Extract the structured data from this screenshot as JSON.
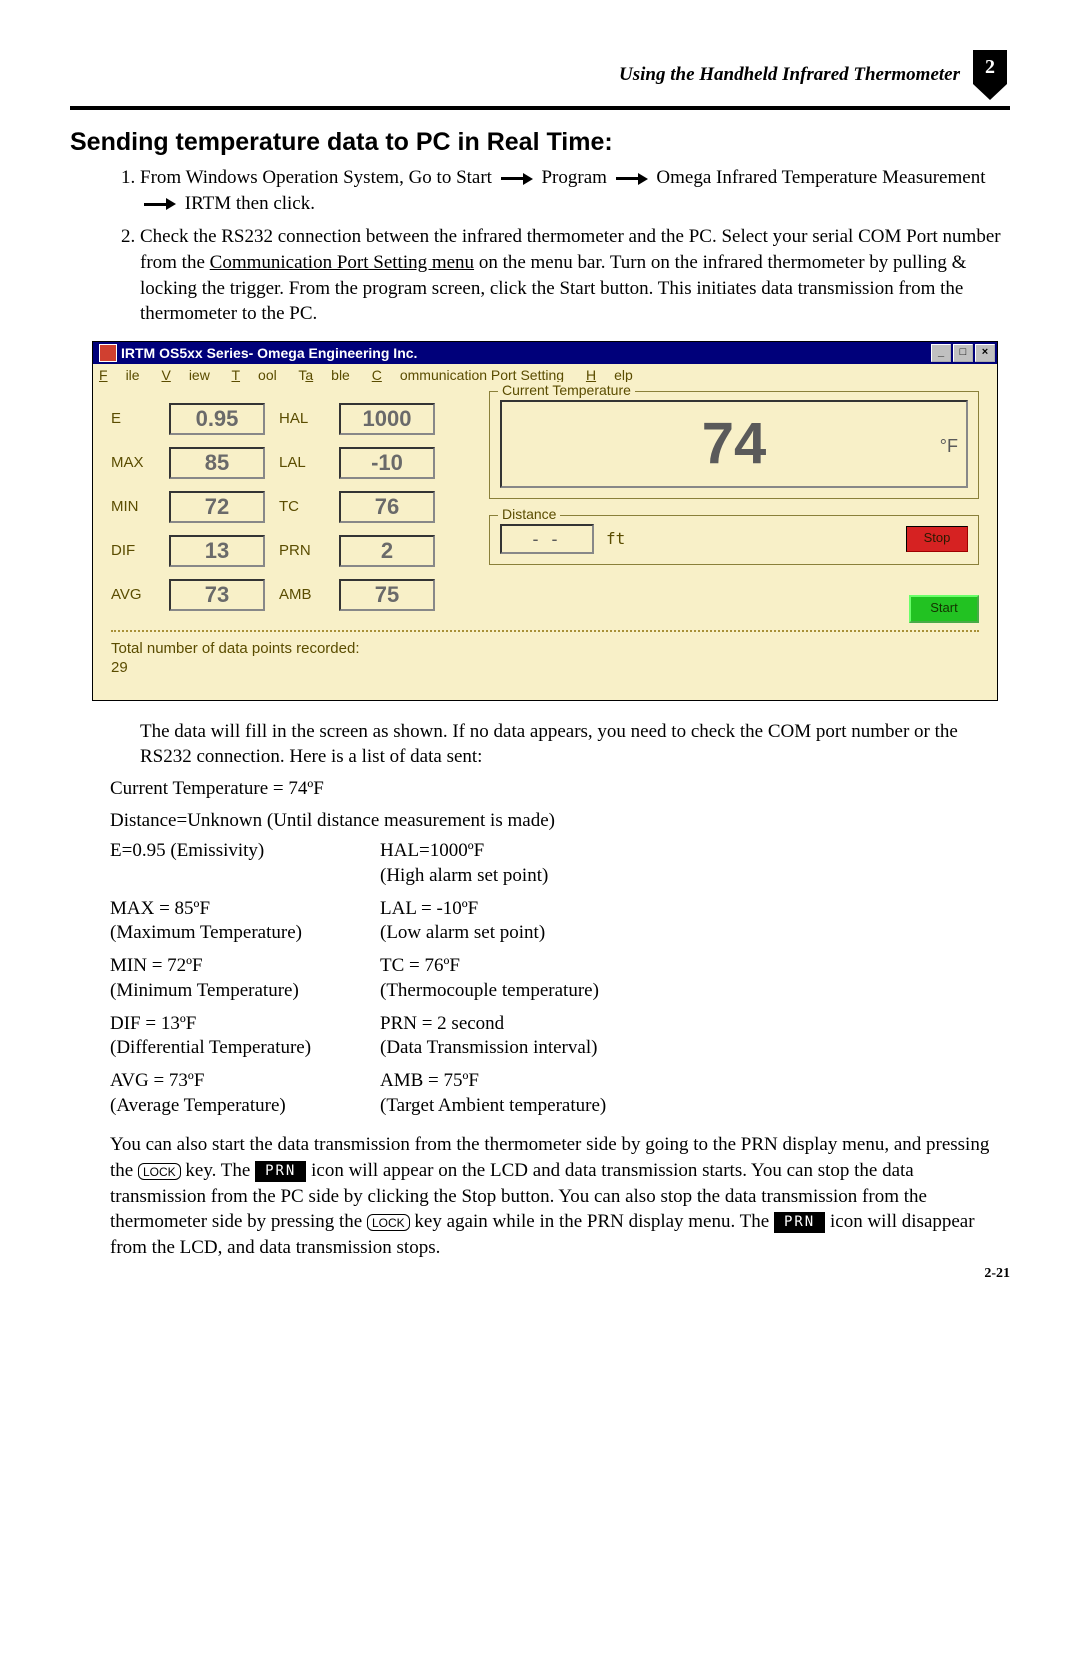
{
  "header": {
    "title": "Using the Handheld Infrared Thermometer",
    "chapter": "2"
  },
  "section_heading": "Sending temperature data to PC in Real Time:",
  "steps": {
    "s1a": "From Windows Operation System, Go to Start",
    "s1b": "Program",
    "s1c": "Omega Infrared Temperature Measurement",
    "s1d": "IRTM then click.",
    "s2a": "Check the RS232 connection between the infrared thermometer and the PC. Select your serial COM Port number from the ",
    "s2b": "Communication Port Setting menu",
    "s2c": " on the menu bar. Turn on the infrared thermometer by pulling & locking the trigger. From the program screen, click the Start button. This initiates data transmission from the thermometer to the PC."
  },
  "app": {
    "title": "IRTM OS5xx Series- Omega Engineering Inc.",
    "menus": {
      "file": "File",
      "view": "View",
      "tool": "Tool",
      "table": "Table",
      "comm": "Communication Port Setting",
      "help": "Help"
    },
    "labels": {
      "E": "E",
      "MAX": "MAX",
      "MIN": "MIN",
      "DIF": "DIF",
      "AVG": "AVG",
      "HAL": "HAL",
      "LAL": "LAL",
      "TC": "TC",
      "PRN": "PRN",
      "AMB": "AMB",
      "curtemp": "Current Temperature",
      "distance": "Distance",
      "ft": "ft",
      "unit": "°F"
    },
    "values": {
      "E": "0.95",
      "MAX": "85",
      "MIN": "72",
      "DIF": "13",
      "AVG": "73",
      "HAL": "1000",
      "LAL": "-10",
      "TC": "76",
      "PRN": "2",
      "AMB": "75",
      "curtemp": "74",
      "distance": "- -"
    },
    "buttons": {
      "stop": "Stop",
      "start": "Start"
    },
    "recorded_label": "Total number of data points recorded:",
    "recorded_count": "29"
  },
  "para_after": "The data will fill in the screen as shown. If no data appears, you need to check the COM port number or the RS232 connection. Here is a list of data sent:",
  "lines": {
    "l1": "Current Temperature = 74ºF",
    "l2": "Distance=Unknown (Until distance measurement is made)"
  },
  "table": {
    "r1a": "E=0.95 (Emissivity)",
    "r1b": "HAL=1000ºF\n(High alarm set point)",
    "r2a": "MAX = 85ºF\n(Maximum Temperature)",
    "r2b": "LAL = -10ºF\n(Low alarm set point)",
    "r3a": "MIN = 72ºF\n(Minimum Temperature)",
    "r3b": "TC = 76ºF\n(Thermocouple temperature)",
    "r4a": "DIF = 13ºF\n(Differential Temperature)",
    "r4b": "PRN = 2 second\n(Data Transmission interval)",
    "r5a": "AVG = 73ºF\n(Average Temperature)",
    "r5b": "AMB = 75ºF\n(Target Ambient temperature)"
  },
  "final": {
    "t1": "You can also start the data transmission from the thermometer side by going to the PRN display menu, and pressing the ",
    "lock": "LOCK",
    "t2": " key. The ",
    "prn": "PRN",
    "t3": " icon will appear on the LCD and data transmission starts. You can stop the data transmission from the PC side by clicking the Stop button. You can also stop the data transmission from the thermometer side by pressing the ",
    "t4": " key again while in the PRN display menu. The ",
    "t5": " icon will disappear from the LCD, and data transmission stops."
  },
  "pagenum": "2-21"
}
